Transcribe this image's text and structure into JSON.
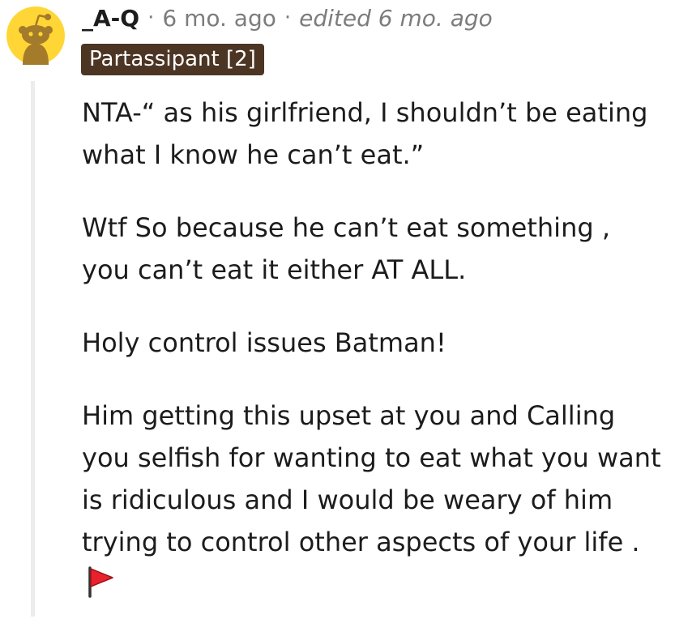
{
  "comment": {
    "username": "_A-Q",
    "separator": "·",
    "timestamp": "6 mo. ago",
    "edited_label": "edited 6 mo. ago",
    "flair": "Partassipant [2]",
    "avatar_icon": "snoo-avatar-icon",
    "paragraphs": [
      "NTA-“ as his girlfriend, I shouldn’t be eating what I know he can’t eat.”",
      "Wtf So because he can’t eat something , you can’t eat it either AT ALL.",
      "Holy control issues Batman!",
      "Him getting this upset at you and Calling you selfish for wanting to eat what you want is ridiculous and I would be weary of him trying to control other aspects of your life ."
    ],
    "trailing_emoji": "red-flag-icon"
  },
  "colors": {
    "avatar_bg": "#ffd635",
    "flair_bg": "#4d3524",
    "meta_text": "#7c7c7c",
    "thread_line": "#ececec",
    "flag_red": "#e8212c"
  }
}
